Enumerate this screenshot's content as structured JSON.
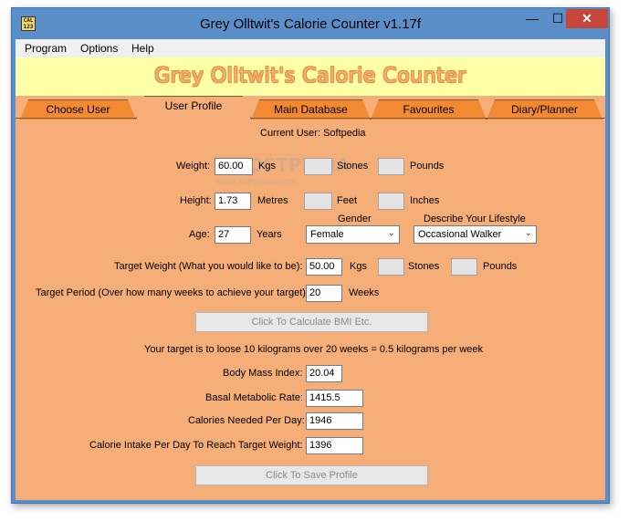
{
  "window": {
    "title": "Grey Olltwit's Calorie Counter v1.17f",
    "icon": "app-calorie-icon"
  },
  "menu": [
    "Program",
    "Options",
    "Help"
  ],
  "banner": "Grey Olltwit's Calorie Counter",
  "tabs": [
    "Choose User",
    "User Profile",
    "Main Database",
    "Favourites",
    "Diary/Planner"
  ],
  "active_tab": "User Profile",
  "current_user": "Current User: Softpedia",
  "weight": {
    "label": "Weight:",
    "value": "60.00",
    "unit": "Kgs",
    "stones_label": "Stones",
    "pounds_label": "Pounds"
  },
  "height": {
    "label": "Height:",
    "value": "1.73",
    "unit": "Metres",
    "feet_label": "Feet",
    "inches_label": "Inches"
  },
  "age": {
    "label": "Age:",
    "value": "27",
    "unit": "Years"
  },
  "gender": {
    "label": "Gender",
    "value": "Female"
  },
  "lifestyle": {
    "label": "Describe Your Lifestyle",
    "value": "Occasional Walker"
  },
  "target_weight": {
    "label": "Target Weight (What you would like to be):",
    "value": "50.00",
    "unit": "Kgs",
    "stones_label": "Stones",
    "pounds_label": "Pounds"
  },
  "target_period": {
    "label": "Target Period (Over how many weeks to achieve your target):",
    "value": "20",
    "unit": "Weeks"
  },
  "calc_button": "Click To Calculate BMI Etc.",
  "summary": "Your target is to loose 10 kilograms over 20 weeks = 0.5 kilograms per week",
  "results": {
    "bmi_label": "Body Mass Index:",
    "bmi_value": "20.04",
    "bmr_label": "Basal Metabolic Rate:",
    "bmr_value": "1415.5",
    "calories_label": "Calories Needed Per Day:",
    "calories_value": "1946",
    "intake_label": "Calorie Intake Per Day To Reach Target Weight:",
    "intake_value": "1396"
  },
  "save_button": "Click To Save Profile",
  "watermark": {
    "main": "SOFTPEDIA",
    "sub": "www.softpedia.com"
  },
  "colors": {
    "background": "#f6ae78",
    "tab": "#f38a31",
    "banner": "#ffffa8",
    "titlebar": "#5b8fc9",
    "close": "#c7463b"
  }
}
